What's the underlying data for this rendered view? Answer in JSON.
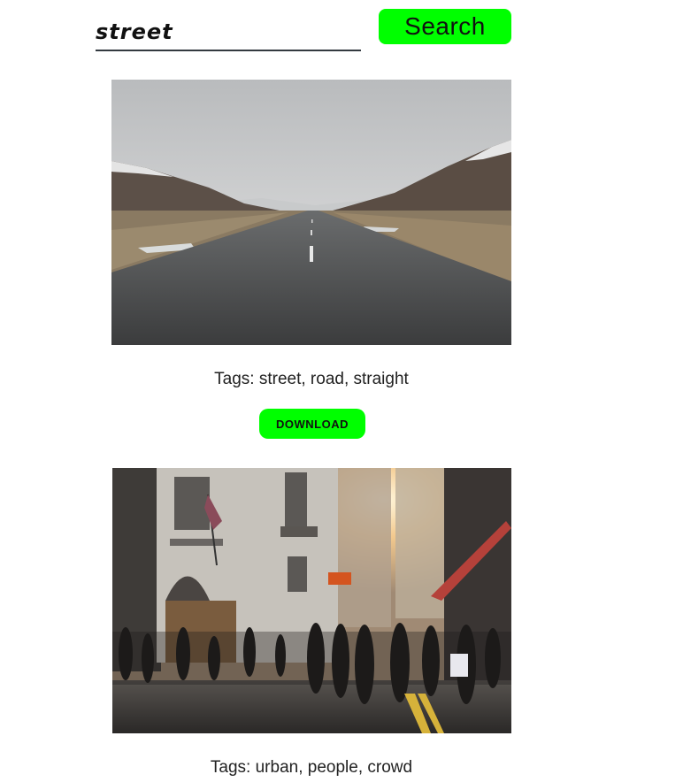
{
  "search": {
    "value": "street",
    "button_label": "Search"
  },
  "results": [
    {
      "tags_label": "Tags: street, road, straight",
      "download_label": "DOWNLOAD"
    },
    {
      "tags_label": "Tags: urban, people, crowd"
    }
  ],
  "colors": {
    "accent": "#00ff00",
    "underline": "#333a40"
  }
}
